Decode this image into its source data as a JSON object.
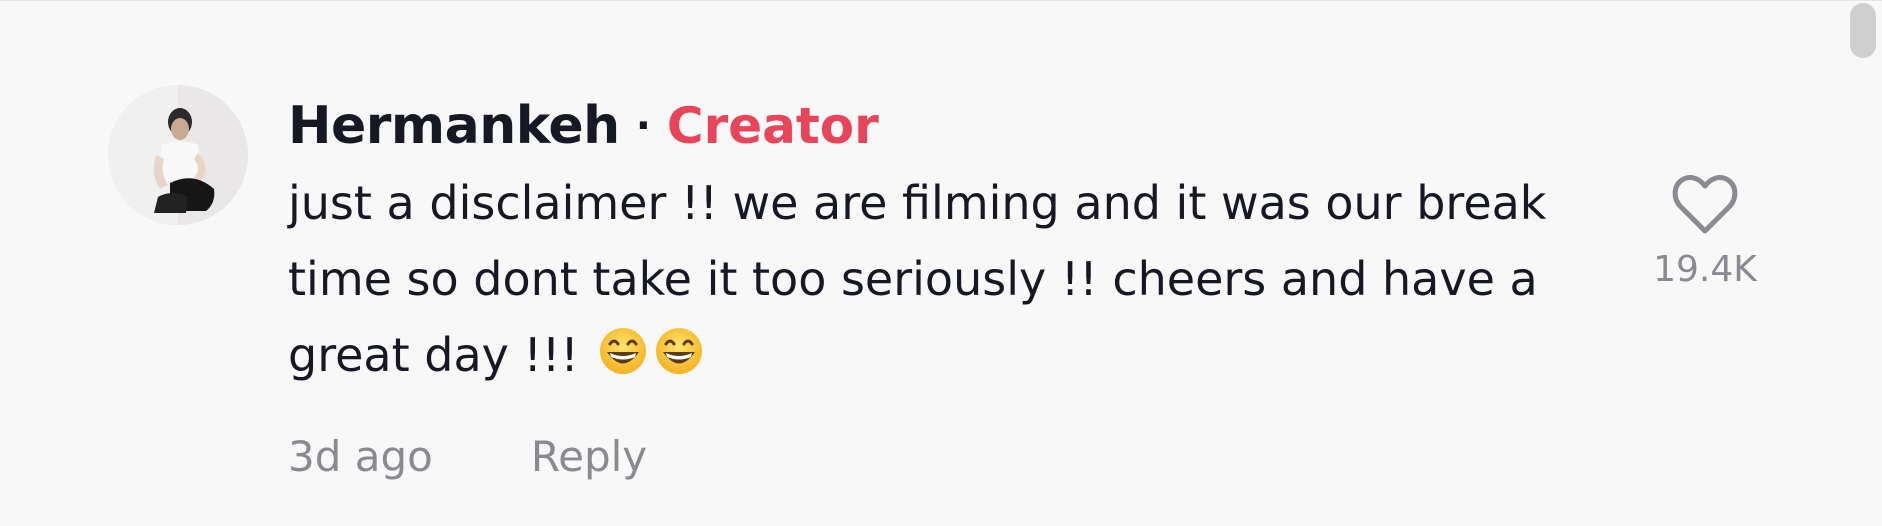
{
  "comment": {
    "author": "Hermankeh",
    "separator": "·",
    "author_badge": "Creator",
    "text": "just a disclaimer !! we are filming and it was our break time so dont take it too seriously !! cheers and have a great day !!!",
    "emojis": [
      "grinning-face-with-smiling-eyes-icon",
      "grinning-face-with-smiling-eyes-icon"
    ],
    "timestamp": "3d ago",
    "reply_label": "Reply",
    "like_count": "19.4K",
    "like_icon": "heart-outline-icon"
  },
  "colors": {
    "background": "#f8f8f8",
    "text_primary": "#161823",
    "badge": "#e8445a",
    "text_secondary": "#8a8b91"
  }
}
